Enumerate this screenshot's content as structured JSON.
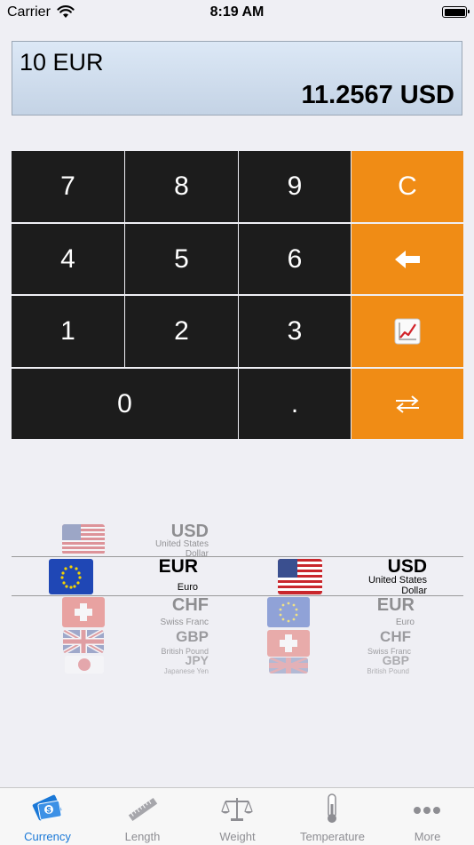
{
  "status_bar": {
    "carrier": "Carrier",
    "time": "8:19 AM"
  },
  "display": {
    "input": "10 EUR",
    "result": "11.2567 USD"
  },
  "keypad": {
    "keys": [
      "7",
      "8",
      "9",
      "C",
      "4",
      "5",
      "6",
      "1",
      "2",
      "3",
      "0",
      "."
    ]
  },
  "pickers": {
    "left": {
      "items": [
        {
          "code": "USD",
          "name": "United States Dollar"
        },
        {
          "code": "EUR",
          "name": "Euro"
        },
        {
          "code": "CHF",
          "name": "Swiss Franc"
        },
        {
          "code": "GBP",
          "name": "British Pound"
        },
        {
          "code": "JPY",
          "name": "Japanese Yen"
        }
      ],
      "selected": "EUR"
    },
    "right": {
      "items": [
        {
          "code": "USD",
          "name": "United States Dollar"
        },
        {
          "code": "EUR",
          "name": "Euro"
        },
        {
          "code": "CHF",
          "name": "Swiss Franc"
        },
        {
          "code": "GBP",
          "name": "British Pound"
        }
      ],
      "selected": "USD"
    }
  },
  "tab_bar": {
    "tabs": [
      {
        "label": "Currency",
        "icon": "currency-icon",
        "active": true
      },
      {
        "label": "Length",
        "icon": "ruler-icon"
      },
      {
        "label": "Weight",
        "icon": "scale-icon"
      },
      {
        "label": "Temperature",
        "icon": "thermometer-icon"
      },
      {
        "label": "More",
        "icon": "more-icon"
      }
    ]
  },
  "colors": {
    "operator_key": "#f08c15",
    "digit_key": "#1c1c1c",
    "active_tab": "#1a78d7",
    "inactive_tab": "#8e8e93"
  }
}
